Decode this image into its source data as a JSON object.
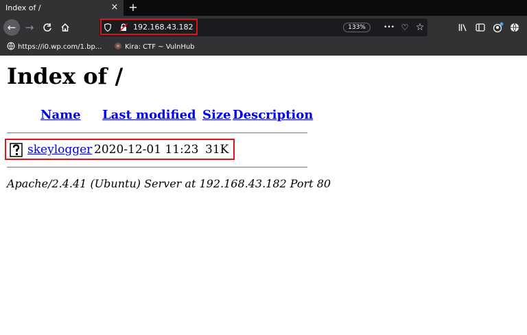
{
  "tab": {
    "title": "Index of /",
    "close": "×",
    "new_tab": "+"
  },
  "nav": {
    "back": "←",
    "forward": "→",
    "reload": "C",
    "home": "⌂",
    "url": "192.168.43.182",
    "zoom": "133%",
    "more": "•••",
    "pocket": "♡",
    "bookmark_star": "☆"
  },
  "bookmarks": [
    {
      "label": "https://i0.wp.com/1.bp...",
      "icon": "globe-icon"
    },
    {
      "label": "Kira: CTF ~ VulnHub",
      "icon": "site-icon"
    }
  ],
  "page": {
    "heading": "Index of /",
    "columns": {
      "name": "Name",
      "modified": "Last modified",
      "size": "Size",
      "description": "Description"
    },
    "rows": [
      {
        "name": "skeylogger",
        "modified": "2020-12-01 11:23",
        "size": "31K",
        "description": ""
      }
    ],
    "footer": "Apache/2.4.41 (Ubuntu) Server at 192.168.43.182 Port 80"
  },
  "colors": {
    "highlight": "#e0131a",
    "link": "#0000ee",
    "chrome": "#323234"
  }
}
